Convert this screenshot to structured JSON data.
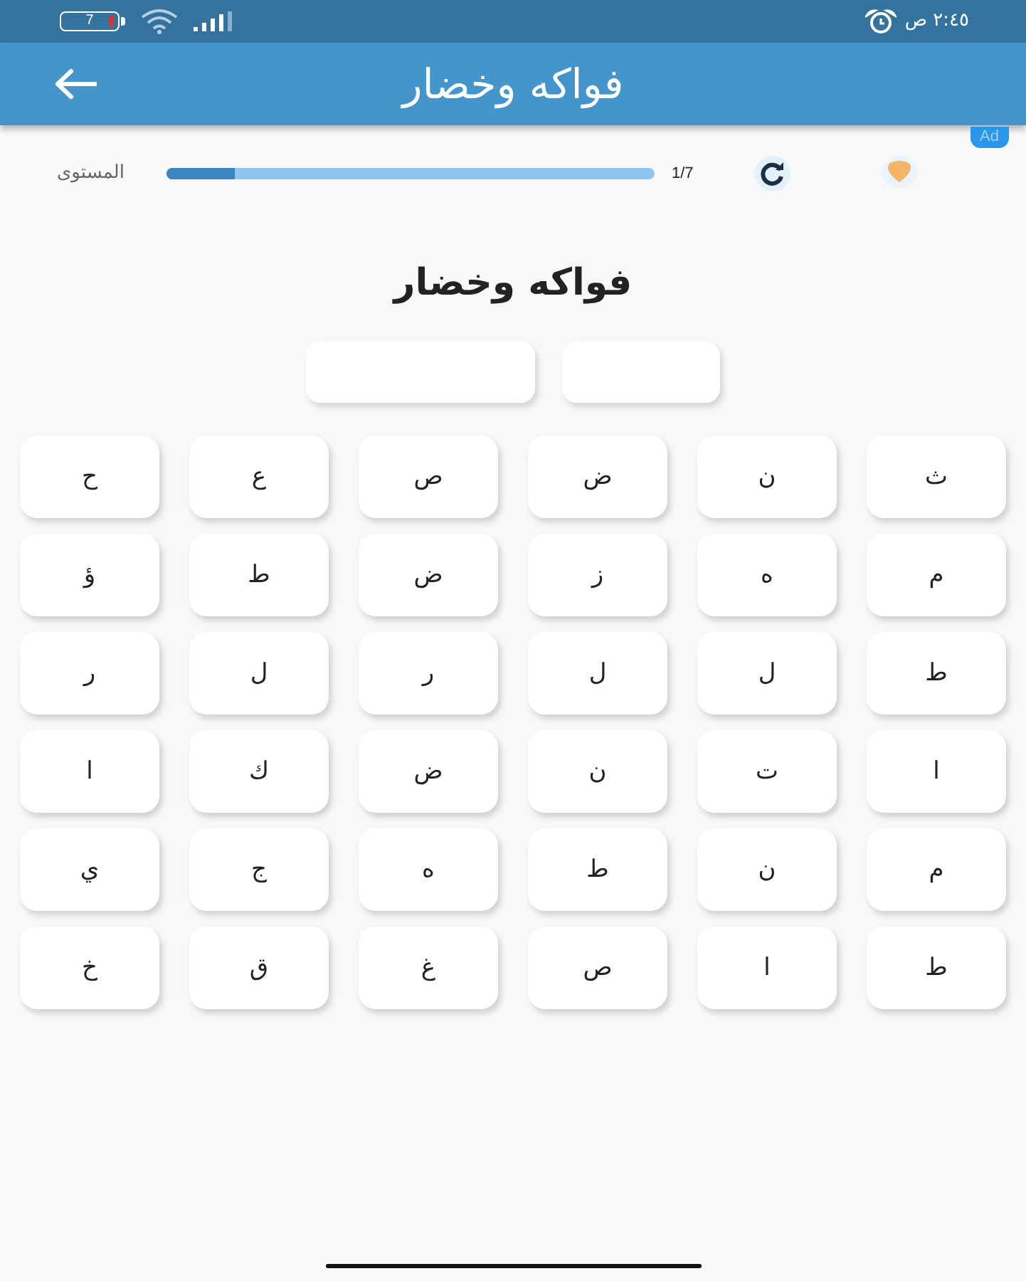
{
  "status_bar": {
    "battery_text": "7",
    "time": "٢:٤٥ ص"
  },
  "app_bar": {
    "title": "فواكه وخضار"
  },
  "ad_badge": "Ad",
  "progress": {
    "label": "المستوى",
    "level": 0.14,
    "count": "1/7"
  },
  "puzzle": {
    "title": "فواكه وخضار",
    "letters": [
      [
        "ث",
        "ن",
        "ض",
        "ص",
        "ع",
        "ح"
      ],
      [
        "م",
        "ه",
        "ز",
        "ض",
        "ط",
        "ؤ"
      ],
      [
        "ط",
        "ل",
        "ل",
        "ر",
        "ل",
        "ر"
      ],
      [
        "ا",
        "ت",
        "ن",
        "ض",
        "ك",
        "ا"
      ],
      [
        "م",
        "ن",
        "ط",
        "ه",
        "ج",
        "ي"
      ],
      [
        "ط",
        "ا",
        "ص",
        "غ",
        "ق",
        "خ"
      ]
    ]
  }
}
